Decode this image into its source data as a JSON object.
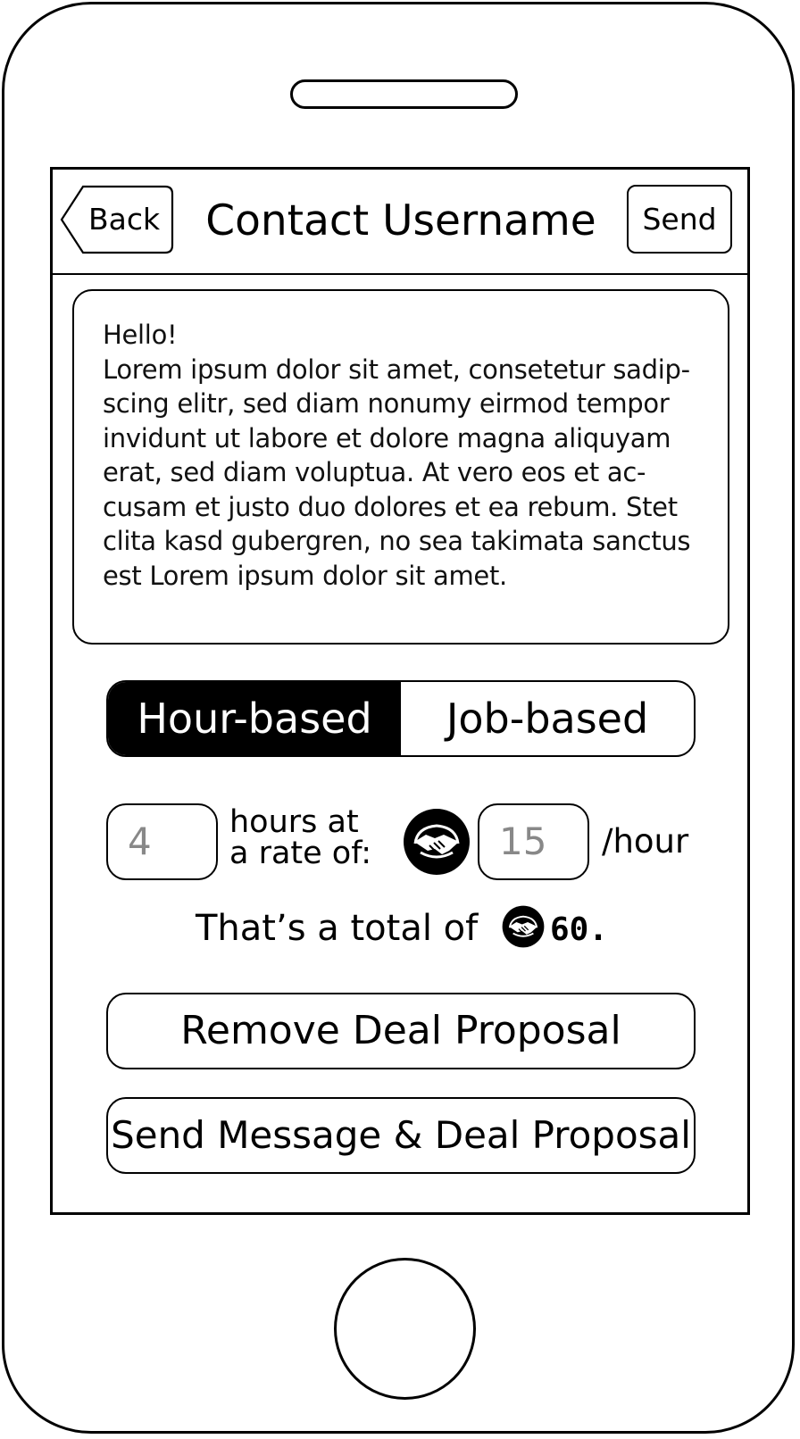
{
  "navbar": {
    "back_label": "Back",
    "title": "Contact Username",
    "send_label": "Send"
  },
  "message": {
    "text": "Hello!\nLorem ipsum dolor sit amet, consetetur sadip-\nscing elitr, sed diam nonumy eirmod tempor\ninvidunt ut labore et dolore magna aliquyam\nerat, sed diam voluptua. At vero eos et ac-\ncusam et justo duo dolores et ea rebum. Stet\nclita kasd gubergren, no sea takimata sanctus\nest Lorem ipsum dolor sit amet."
  },
  "deal_type": {
    "options": [
      "Hour-based",
      "Job-based"
    ],
    "selected": "Hour-based"
  },
  "rate": {
    "hours_placeholder": "4",
    "label_line1": "hours at",
    "label_line2": "a rate of:",
    "rate_placeholder": "15",
    "per_unit": "/hour",
    "currency_icon": "handshake-coin-icon"
  },
  "total": {
    "prefix": "That’s a total of",
    "amount": "60."
  },
  "actions": {
    "remove_label": "Remove Deal Proposal",
    "send_label": "Send Message & Deal Proposal"
  },
  "colors": {
    "ink": "#000000",
    "background": "#ffffff",
    "placeholder": "#888888"
  }
}
